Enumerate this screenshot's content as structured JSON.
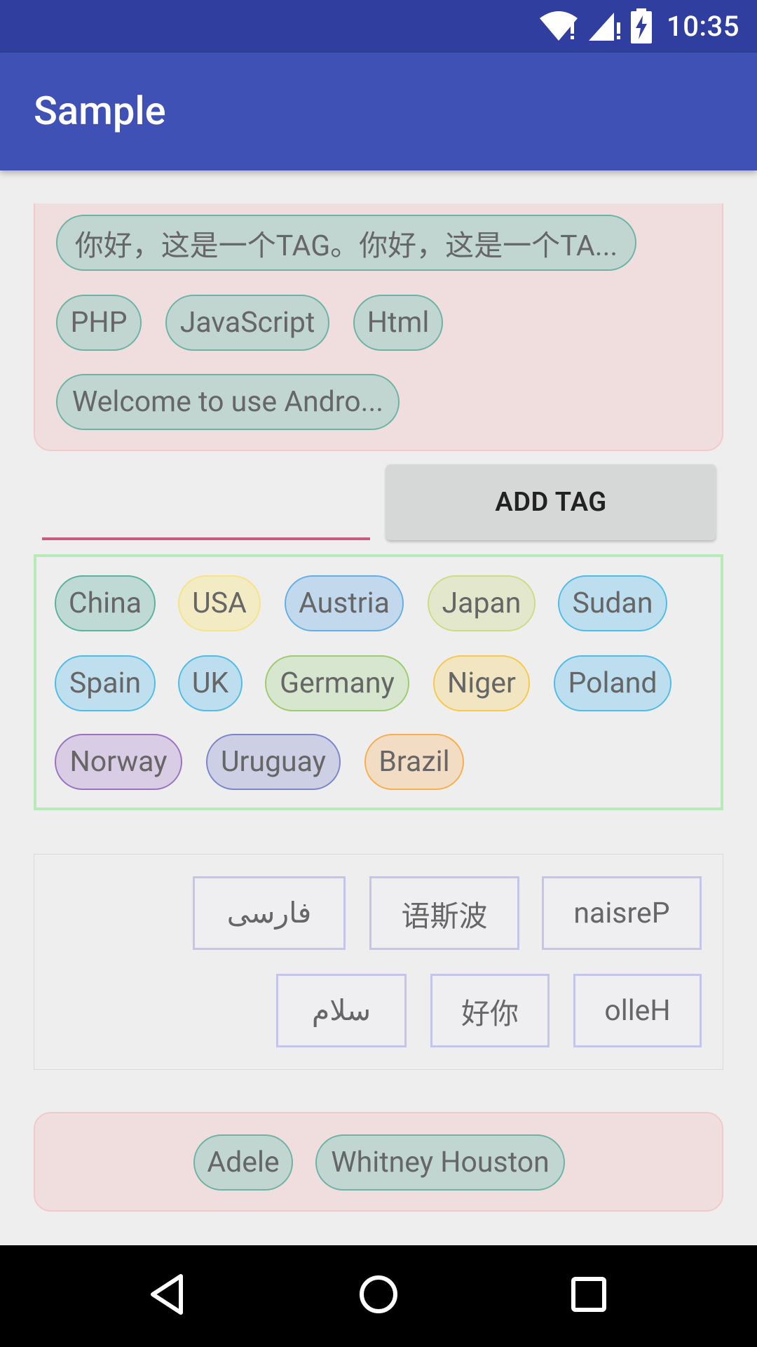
{
  "status_bar": {
    "time": "10:35",
    "icons": [
      "wifi-icon",
      "signal-icon",
      "battery-charging-icon"
    ]
  },
  "app_bar": {
    "title": "Sample"
  },
  "tag_group_1": {
    "tags": [
      "你好，这是一个TAG。你好，这是一个TA...",
      "PHP",
      "JavaScript",
      "Html",
      "Welcome to use Andro..."
    ],
    "background": "#F0DEDE"
  },
  "input": {
    "value": "",
    "placeholder": ""
  },
  "add_button": {
    "label": "ADD TAG"
  },
  "tag_group_2": {
    "tags": [
      {
        "label": "China",
        "bg": "#BFD9D5",
        "border": "#5CB0A0"
      },
      {
        "label": "USA",
        "bg": "#F2EBC3",
        "border": "#F5E38A"
      },
      {
        "label": "Austria",
        "bg": "#C2D9ED",
        "border": "#64AEE8"
      },
      {
        "label": "Japan",
        "bg": "#E3E8CC",
        "border": "#CDDC84"
      },
      {
        "label": "Sudan",
        "bg": "#BDDEEF",
        "border": "#4FBCE8"
      },
      {
        "label": "Spain",
        "bg": "#BFDFEE",
        "border": "#4FBCE8"
      },
      {
        "label": "UK",
        "bg": "#BDDEEF",
        "border": "#4FBCE8"
      },
      {
        "label": "Germany",
        "bg": "#D7E6CE",
        "border": "#9CCC6E"
      },
      {
        "label": "Niger",
        "bg": "#F2E6C2",
        "border": "#F8C84A"
      },
      {
        "label": "Poland",
        "bg": "#BDDEEF",
        "border": "#4FBCE8"
      },
      {
        "label": "Norway",
        "bg": "#D8CDE4",
        "border": "#9A72C2"
      },
      {
        "label": "Uruguay",
        "bg": "#CDD0E4",
        "border": "#7986CB"
      },
      {
        "label": "Brazil",
        "bg": "#F3DCC4",
        "border": "#F7AE4C"
      }
    ],
    "border_color": "#B8EAB8"
  },
  "tag_group_3": {
    "tags": [
      "فارسی",
      "语斯波",
      "naisreP",
      "سلام",
      "好你",
      "olleH"
    ]
  },
  "tag_group_4": {
    "tags": [
      "Adele",
      "Whitney Houston"
    ]
  },
  "nav_bar": {
    "buttons": [
      "back-icon",
      "home-icon",
      "recents-icon"
    ]
  }
}
